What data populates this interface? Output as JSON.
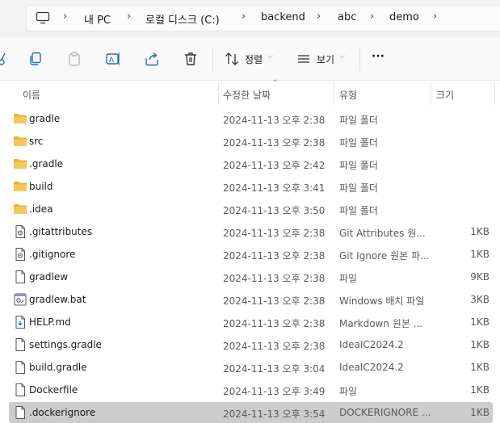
{
  "breadcrumb": {
    "items": [
      "내 PC",
      "로컬 디스크 (C:)",
      "backend",
      "abc",
      "demo"
    ]
  },
  "toolbar": {
    "sort_label": "정렬",
    "view_label": "보기",
    "more_label": "···"
  },
  "columns": {
    "name": "이름",
    "date": "수정한 날짜",
    "type": "유형",
    "size": "크기"
  },
  "files": [
    {
      "name": "gradle",
      "date": "2024-11-13 오후 2:38",
      "type": "파일 폴더",
      "size": "",
      "icon": "folder-icon"
    },
    {
      "name": "src",
      "date": "2024-11-13 오후 2:38",
      "type": "파일 폴더",
      "size": "",
      "icon": "folder-icon"
    },
    {
      "name": ".gradle",
      "date": "2024-11-13 오후 2:42",
      "type": "파일 폴더",
      "size": "",
      "icon": "folder-icon"
    },
    {
      "name": "build",
      "date": "2024-11-13 오후 3:41",
      "type": "파일 폴더",
      "size": "",
      "icon": "folder-icon"
    },
    {
      "name": ".idea",
      "date": "2024-11-13 오후 3:50",
      "type": "파일 폴더",
      "size": "",
      "icon": "folder-icon"
    },
    {
      "name": ".gitattributes",
      "date": "2024-11-13 오후 2:38",
      "type": "Git Attributes 원...",
      "size": "1KB",
      "icon": "config-file-icon"
    },
    {
      "name": ".gitignore",
      "date": "2024-11-13 오후 2:38",
      "type": "Git Ignore 원본 파...",
      "size": "1KB",
      "icon": "config-file-icon"
    },
    {
      "name": "gradlew",
      "date": "2024-11-13 오후 2:38",
      "type": "파일",
      "size": "9KB",
      "icon": "file-icon"
    },
    {
      "name": "gradlew.bat",
      "date": "2024-11-13 오후 2:38",
      "type": "Windows 배치 파일",
      "size": "3KB",
      "icon": "batch-file-icon"
    },
    {
      "name": "HELP.md",
      "date": "2024-11-13 오후 2:38",
      "type": "Markdown 원본 ...",
      "size": "1KB",
      "icon": "markdown-file-icon"
    },
    {
      "name": "settings.gradle",
      "date": "2024-11-13 오후 2:38",
      "type": "IdeaIC2024.2",
      "size": "1KB",
      "icon": "file-icon"
    },
    {
      "name": "build.gradle",
      "date": "2024-11-13 오후 3:04",
      "type": "IdeaIC2024.2",
      "size": "1KB",
      "icon": "file-icon"
    },
    {
      "name": "Dockerfile",
      "date": "2024-11-13 오후 3:49",
      "type": "파일",
      "size": "1KB",
      "icon": "file-icon"
    },
    {
      "name": ".dockerignore",
      "date": "2024-11-13 오후 3:54",
      "type": "DOCKERIGNORE ...",
      "size": "1KB",
      "icon": "file-icon",
      "selected": true
    }
  ],
  "colors": {
    "folder": "#e8b43a",
    "selection": "#cccccc",
    "address_bg": "#f3f3f3"
  }
}
